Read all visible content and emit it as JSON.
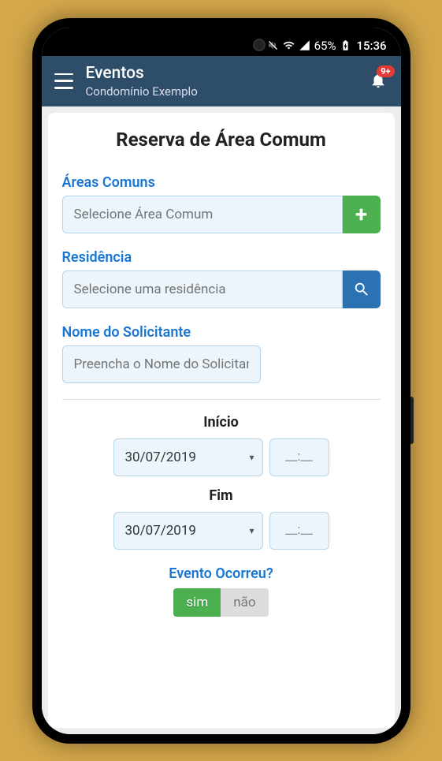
{
  "status_bar": {
    "battery": "65%",
    "time": "15:36"
  },
  "header": {
    "title": "Eventos",
    "subtitle": "Condomínio Exemplo",
    "notification_count": "9+"
  },
  "form": {
    "title": "Reserva de Área Comum",
    "areas_comuns": {
      "label": "Áreas Comuns",
      "placeholder": "Selecione Área Comum"
    },
    "residencia": {
      "label": "Residência",
      "placeholder": "Selecione uma residência"
    },
    "solicitante": {
      "label": "Nome do Solicitante",
      "placeholder": "Preencha o Nome do Solicitante"
    },
    "inicio": {
      "label": "Início",
      "date": "30/07/2019",
      "time": "__:__"
    },
    "fim": {
      "label": "Fim",
      "date": "30/07/2019",
      "time": "__:__"
    },
    "evento_ocorreu": {
      "label": "Evento Ocorreu?",
      "sim": "sim",
      "nao": "não"
    }
  }
}
